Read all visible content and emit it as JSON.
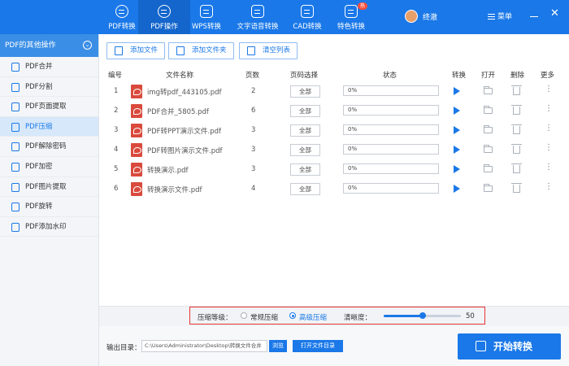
{
  "toolbar_top": {
    "tools": [
      {
        "label": "PDF转换",
        "icon": "convert-icon"
      },
      {
        "label": "PDF操作",
        "icon": "settings-icon",
        "active": true
      },
      {
        "label": "WPS转换",
        "icon": "wps-icon"
      },
      {
        "label": "文字语音转换",
        "icon": "audio-icon"
      },
      {
        "label": "CAD转换",
        "icon": "cad-icon"
      },
      {
        "label": "特色转换",
        "icon": "special-icon",
        "badge": "热"
      }
    ],
    "username": "终澈",
    "menu_label": "菜单",
    "close_symbol": "✕"
  },
  "sidebar": {
    "title": "PDF的其他操作",
    "items": [
      {
        "label": "PDF合并"
      },
      {
        "label": "PDF分割"
      },
      {
        "label": "PDF页面提取"
      },
      {
        "label": "PDF压缩",
        "active": true
      },
      {
        "label": "PDF解除密码"
      },
      {
        "label": "PDF加密"
      },
      {
        "label": "PDF图片提取"
      },
      {
        "label": "PDF旋转"
      },
      {
        "label": "PDF添加水印"
      }
    ]
  },
  "actions": {
    "add_file": "添加文件",
    "add_folder": "添加文件夹",
    "clear_list": "清空列表"
  },
  "table": {
    "headers": {
      "index": "编号",
      "filename": "文件名称",
      "pages": "页数",
      "page_select": "页码选择",
      "status": "状态",
      "convert": "转换",
      "open": "打开",
      "delete": "删除",
      "more": "更多"
    },
    "rows": [
      {
        "index": "1",
        "filename": "img转pdf_443105.pdf",
        "pages": "2",
        "page_select": "全部",
        "progress": "0%",
        "progress_value": 0
      },
      {
        "index": "2",
        "filename": "PDF合并_5805.pdf",
        "pages": "6",
        "page_select": "全部",
        "progress": "0%",
        "progress_value": 0
      },
      {
        "index": "3",
        "filename": "PDF转PPT演示文件.pdf",
        "pages": "3",
        "page_select": "全部",
        "progress": "0%",
        "progress_value": 0
      },
      {
        "index": "4",
        "filename": "PDF转图片演示文件.pdf",
        "pages": "3",
        "page_select": "全部",
        "progress": "0%",
        "progress_value": 0
      },
      {
        "index": "5",
        "filename": "转换演示.pdf",
        "pages": "3",
        "page_select": "全部",
        "progress": "0%",
        "progress_value": 0
      },
      {
        "index": "6",
        "filename": "转换演示文件.pdf",
        "pages": "4",
        "page_select": "全部",
        "progress": "0%",
        "progress_value": 0
      }
    ],
    "more_symbol": "⋮"
  },
  "compress": {
    "level_label": "压缩等级：",
    "option_normal": "常规压缩",
    "option_advanced": "高级压缩",
    "selected": "advanced",
    "clarity_label": "清晰度：",
    "clarity_value": "50",
    "clarity_fraction": 0.5
  },
  "output": {
    "label": "输出目录：",
    "path": "C:\\Users\\Administrator\\Desktop\\转换文件合并",
    "browse": "浏览",
    "open_dir": "打开文件目录"
  },
  "start_button": "开始转换",
  "colors": {
    "primary": "#1a78e8",
    "highlight": "#e63535",
    "pdf_red": "#d94a3d"
  }
}
